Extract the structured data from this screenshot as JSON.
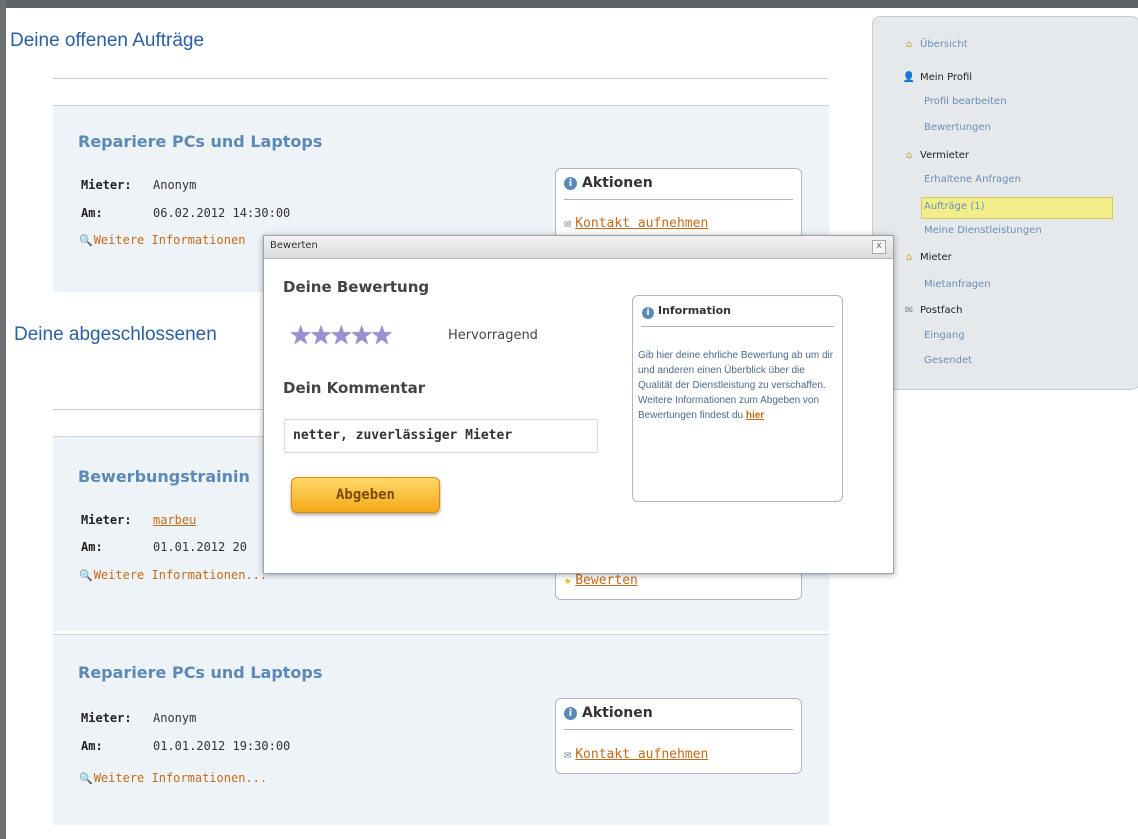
{
  "open_orders": {
    "heading": "Deine offenen Aufträge",
    "card": {
      "title": "Repariere PCs und Laptops",
      "renter_label": "Mieter:",
      "renter_value": "Anonym",
      "date_label": "Am:",
      "date_value": "06.02.2012 14:30:00",
      "more_info": "Weitere Informationen",
      "actions_title": "Aktionen",
      "action": "Kontakt aufnehmen"
    }
  },
  "closed_orders": {
    "heading": "Deine abgeschlossenen",
    "card1": {
      "title": "Bewerbungstrainin",
      "renter_label": "Mieter:",
      "renter_value": "marbeu",
      "date_label": "Am:",
      "date_value": "01.01.2012 20",
      "more_info": "Weitere Informationen...",
      "action": "Bewerten"
    },
    "card2": {
      "title": "Repariere PCs und Laptops",
      "renter_label": "Mieter:",
      "renter_value": "Anonym",
      "date_label": "Am:",
      "date_value": "01.01.2012 19:30:00",
      "more_info": "Weitere Informationen...",
      "actions_title": "Aktionen",
      "action": "Kontakt aufnehmen"
    }
  },
  "sidebar": {
    "overview": "Übersicht",
    "profile": "Mein Profil",
    "profile_edit": "Profil bearbeiten",
    "ratings": "Bewertungen",
    "landlord": "Vermieter",
    "received_requests": "Erhaltene Anfragen",
    "orders": "Aufträge (1)",
    "my_services": "Meine Dienstleistungen",
    "tenant": "Mieter",
    "tenant_requests": "Mietanfragen",
    "mailbox": "Postfach",
    "inbox": "Eingang",
    "sent": "Gesendet"
  },
  "dialog": {
    "window_title": "Bewerten",
    "close": "x",
    "rating_heading": "Deine Bewertung",
    "rating_value": 5,
    "rating_max": 5,
    "rating_text": "Hervorragend",
    "comment_heading": "Dein Kommentar",
    "comment_value": "netter, zuverlässiger Mieter",
    "submit": "Abgeben",
    "info_title": "Information",
    "info_text": "Gib hier deine ehrliche Bewertung ab um dir und anderen einen Überblick über die Qualität der Dienstleistung zu verschaffen. Weitere Informationen zum Abgeben von Bewertungen findest du",
    "info_link": "hier"
  },
  "colors": {
    "heading": "#2a5fa0",
    "card_title": "#5a8ab5",
    "link": "#c46b1a",
    "button": "#f3a815",
    "active_nav": "#f3ee8c"
  }
}
